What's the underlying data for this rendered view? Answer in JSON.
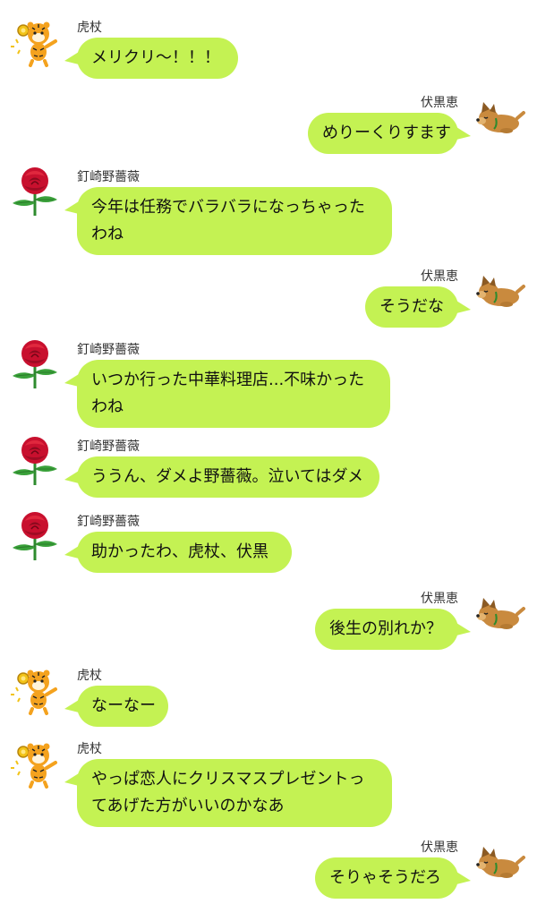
{
  "colors": {
    "bubble": "#c4f253",
    "background": "#ffffff"
  },
  "messages": [
    {
      "side": "left",
      "sender": "虎杖",
      "avatar": "tiger-icon",
      "lines": [
        "メリクリ〜！！！"
      ]
    },
    {
      "side": "right",
      "sender": "伏黒恵",
      "avatar": "dog-icon",
      "lines": [
        "めりーくりすます"
      ]
    },
    {
      "side": "left",
      "sender": "釘崎野薔薇",
      "avatar": "rose-icon",
      "lines": [
        "今年は任務でバラバラになっちゃった",
        "わね"
      ]
    },
    {
      "side": "right",
      "sender": "伏黒恵",
      "avatar": "dog-icon",
      "lines": [
        "そうだな"
      ]
    },
    {
      "side": "left",
      "sender": "釘崎野薔薇",
      "avatar": "rose-icon",
      "lines": [
        "いつか行った中華料理店...不味かった",
        "わね"
      ]
    },
    {
      "side": "left",
      "sender": "釘崎野薔薇",
      "avatar": "rose-icon",
      "lines": [
        "ううん、ダメよ野薔薇。泣いてはダメ"
      ]
    },
    {
      "side": "left",
      "sender": "釘崎野薔薇",
      "avatar": "rose-icon",
      "lines": [
        "助かったわ、虎杖、伏黒"
      ]
    },
    {
      "side": "right",
      "sender": "伏黒恵",
      "avatar": "dog-icon",
      "lines": [
        "後生の別れか？"
      ]
    },
    {
      "side": "left",
      "sender": "虎杖",
      "avatar": "tiger-icon",
      "lines": [
        "なーなー"
      ]
    },
    {
      "side": "left",
      "sender": "虎杖",
      "avatar": "tiger-icon",
      "lines": [
        "やっぱ恋人にクリスマスプレゼントっ",
        "てあげた方がいいのかなあ"
      ]
    },
    {
      "side": "right",
      "sender": "伏黒恵",
      "avatar": "dog-icon",
      "lines": [
        "そりゃそうだろ"
      ]
    }
  ]
}
